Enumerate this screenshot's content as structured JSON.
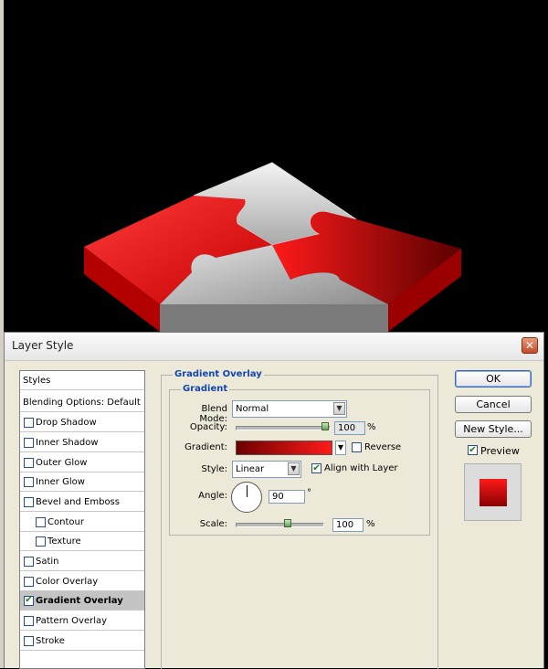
{
  "dialog": {
    "title": "Layer Style",
    "close_glyph": "✕"
  },
  "left_panel": {
    "styles_label": "Styles",
    "blending_label": "Blending Options: Default",
    "items": [
      {
        "label": "Drop Shadow",
        "checked": false
      },
      {
        "label": "Inner Shadow",
        "checked": false
      },
      {
        "label": "Outer Glow",
        "checked": false
      },
      {
        "label": "Inner Glow",
        "checked": false
      },
      {
        "label": "Bevel and Emboss",
        "checked": false
      },
      {
        "label": "Contour",
        "checked": false
      },
      {
        "label": "Texture",
        "checked": false
      },
      {
        "label": "Satin",
        "checked": false
      },
      {
        "label": "Color Overlay",
        "checked": false
      },
      {
        "label": "Gradient Overlay",
        "checked": true
      },
      {
        "label": "Pattern Overlay",
        "checked": false
      },
      {
        "label": "Stroke",
        "checked": false
      }
    ]
  },
  "gradient_overlay": {
    "section_title": "Gradient Overlay",
    "group_title": "Gradient",
    "blend_mode_label": "Blend Mode:",
    "blend_mode_value": "Normal",
    "opacity_label": "Opacity:",
    "opacity_value": "100",
    "opacity_unit": "%",
    "opacity_level": 1.0,
    "gradient_label": "Gradient:",
    "gradient_colors": [
      "#6e0000",
      "#ff1a1a"
    ],
    "reverse_label": "Reverse",
    "reverse_checked": false,
    "style_label": "Style:",
    "style_value": "Linear",
    "align_label": "Align with Layer",
    "align_checked": true,
    "angle_label": "Angle:",
    "angle_value": "90",
    "angle_unit": "°",
    "scale_label": "Scale:",
    "scale_value": "100",
    "scale_unit": "%",
    "scale_level": 0.6
  },
  "buttons": {
    "ok": "OK",
    "cancel": "Cancel",
    "new_style": "New Style...",
    "preview_label": "Preview",
    "preview_checked": true
  },
  "icons": {
    "check": "✔",
    "dropdown": "▼"
  },
  "colors": {
    "puzzle_red": "#ff0000",
    "puzzle_gray": "#c8c8c8",
    "accent_blue": "#1246b0"
  }
}
